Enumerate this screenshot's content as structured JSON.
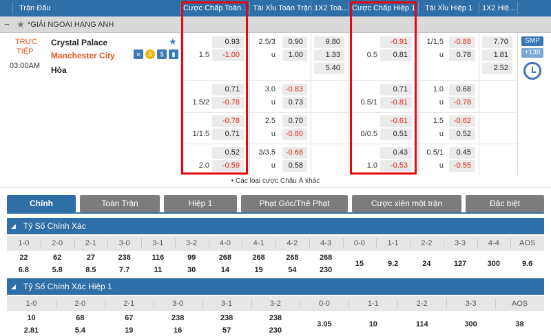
{
  "header": {
    "col_match": "Trận Đấu",
    "col_ah_ft": "Cược Chấp Toàn ...",
    "col_ou_ft": "Tài Xỉu Toàn Trận",
    "col_1x2_ft": "1X2 Toà...",
    "col_ah_h1": "Cược Chấp Hiệp 1",
    "col_ou_h1": "Tài Xỉu Hiệp 1",
    "col_1x2_h1": "1X2 Hiệ..."
  },
  "league": {
    "collapse": "−",
    "star": "★",
    "name": "*GIẢI NGOẠI HẠNG ANH"
  },
  "match": {
    "status_line1": "TRỰC",
    "status_line2": "TIẾP",
    "time": "03:00AM",
    "home": "Crystal Palace",
    "away": "Manchester City",
    "draw": "Hòa",
    "smp": "SMP",
    "more_count": "+138",
    "more_bets": "• Các loại cược Châu Á khác"
  },
  "markets": {
    "ah_ft": [
      {
        "line_top": "",
        "line_bot": "1.5",
        "top": "0.93",
        "bot": "-1.00"
      },
      {
        "line_top": "",
        "line_bot": "1.5/2",
        "top": "0.71",
        "bot": "-0.78"
      },
      {
        "line_top": "",
        "line_bot": "1/1.5",
        "top": "-0.78",
        "bot": "0.71"
      },
      {
        "line_top": "",
        "line_bot": "2.0",
        "top": "0.52",
        "bot": "-0.59"
      }
    ],
    "ou_ft": [
      {
        "line_top": "2.5/3",
        "line_bot": "u",
        "top": "0.90",
        "bot": "1.00"
      },
      {
        "line_top": "3.0",
        "line_bot": "u",
        "top": "-0.83",
        "bot": "0.73"
      },
      {
        "line_top": "2.5",
        "line_bot": "u",
        "top": "0.70",
        "bot": "-0.80"
      },
      {
        "line_top": "3/3.5",
        "line_bot": "u",
        "top": "-0.68",
        "bot": "0.58"
      }
    ],
    "x12_ft": [
      "9.80",
      "1.33",
      "5.40"
    ],
    "ah_h1": [
      {
        "line_top": "",
        "line_bot": "0.5",
        "top": "-0.91",
        "bot": "0.81"
      },
      {
        "line_top": "",
        "line_bot": "0.5/1",
        "top": "0.71",
        "bot": "-0.81"
      },
      {
        "line_top": "",
        "line_bot": "0/0.5",
        "top": "-0.61",
        "bot": "0.51"
      },
      {
        "line_top": "",
        "line_bot": "1.0",
        "top": "0.43",
        "bot": "-0.53"
      }
    ],
    "ou_h1": [
      {
        "line_top": "1/1.5",
        "line_bot": "u",
        "top": "-0.88",
        "bot": "0.78"
      },
      {
        "line_top": "1.0",
        "line_bot": "u",
        "top": "0.68",
        "bot": "-0.78"
      },
      {
        "line_top": "1.5",
        "line_bot": "u",
        "top": "-0.62",
        "bot": "0.52"
      },
      {
        "line_top": "0.5/1",
        "line_bot": "u",
        "top": "0.45",
        "bot": "-0.55"
      }
    ],
    "x12_h1": [
      "7.70",
      "1.81",
      "2.52"
    ]
  },
  "tabs": [
    "Chính",
    "Toàn Trận",
    "Hiệp 1",
    "Phạt Góc/Thẻ Phạt",
    "Cược xiên một trận",
    "Đặc biệt"
  ],
  "section1": {
    "title": "Tỷ Số Chính Xác",
    "headers": [
      "1-0",
      "2-0",
      "2-1",
      "3-0",
      "3-1",
      "3-2",
      "4-0",
      "4-1",
      "4-2",
      "4-3",
      "0-0",
      "1-1",
      "2-2",
      "3-3",
      "4-4",
      "AOS"
    ],
    "top": [
      "22",
      "62",
      "27",
      "238",
      "116",
      "99",
      "268",
      "268",
      "268",
      "268",
      "15",
      "9.2",
      "24",
      "127",
      "300",
      "9.6"
    ],
    "bot": [
      "6.8",
      "5.8",
      "8.5",
      "7.7",
      "11",
      "30",
      "14",
      "19",
      "54",
      "230",
      "",
      "",
      "",
      "",
      "",
      ""
    ]
  },
  "section2": {
    "title": "Tỷ Số Chính Xác Hiệp 1",
    "headers": [
      "1-0",
      "2-0",
      "2-1",
      "3-0",
      "3-1",
      "3-2",
      "0-0",
      "1-1",
      "2-2",
      "3-3",
      "AOS"
    ],
    "top": [
      "10",
      "68",
      "67",
      "238",
      "238",
      "238",
      "3.05",
      "10",
      "114",
      "300",
      "38"
    ],
    "bot": [
      "2.81",
      "5.4",
      "19",
      "16",
      "57",
      "230",
      "",
      "",
      "",
      "",
      ""
    ]
  },
  "colors": {
    "header": "#2f6fa7",
    "negative": "#e0281c",
    "team_away": "#e2561a",
    "highlight": "#e8060c"
  }
}
